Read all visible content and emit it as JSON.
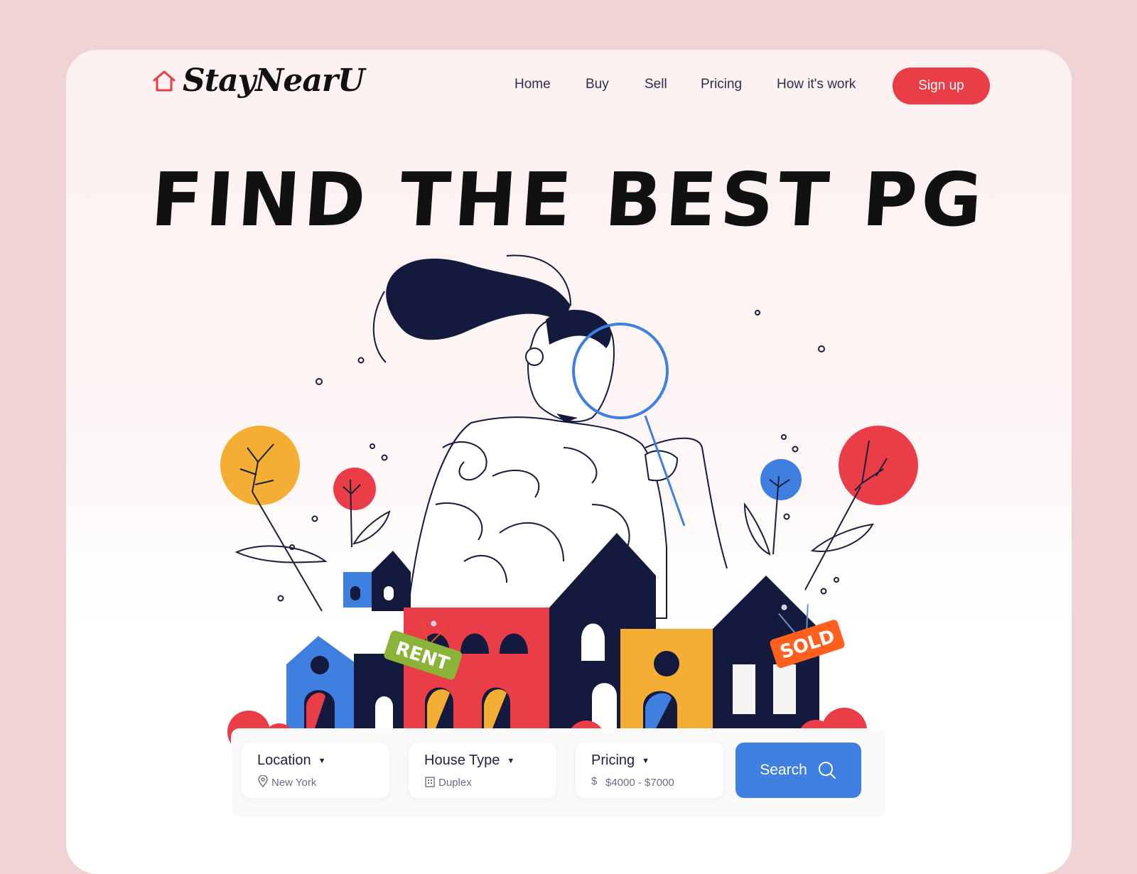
{
  "brand": {
    "name": "StayNearU",
    "accent": "#ea3d48"
  },
  "nav": {
    "items": [
      {
        "label": "Home"
      },
      {
        "label": "Buy"
      },
      {
        "label": "Sell"
      },
      {
        "label": "Pricing"
      },
      {
        "label": "How it's work"
      }
    ],
    "signup_label": "Sign up"
  },
  "hero": {
    "headline": "FIND THE BEST PG",
    "signs": {
      "rent": "RENT",
      "sold": "SOLD"
    }
  },
  "search": {
    "location": {
      "label": "Location",
      "value": "New York",
      "icon": "location-pin-icon"
    },
    "house_type": {
      "label": "House Type",
      "value": "Duplex",
      "icon": "building-icon"
    },
    "pricing": {
      "label": "Pricing",
      "value": "$4000 - $7000",
      "icon": "dollar-icon"
    },
    "button_label": "Search",
    "button_color": "#3f7fe0"
  }
}
